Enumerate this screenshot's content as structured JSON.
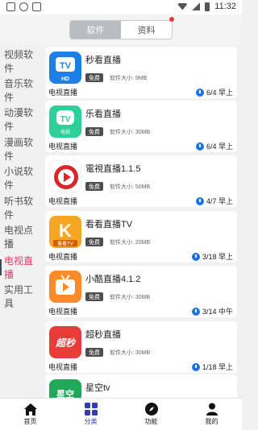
{
  "status": {
    "time": "11:32"
  },
  "segment": {
    "tabs": [
      "软件",
      "资料"
    ],
    "active": 0
  },
  "sidebar": {
    "items": [
      "视频软件",
      "音乐软件",
      "动漫软件",
      "漫画软件",
      "小说软件",
      "听书软件",
      "电视点播",
      "电视直播",
      "实用工具"
    ],
    "active_index": 7
  },
  "apps": [
    {
      "name": "秒看直播",
      "badge": "免费",
      "size": "软件大小: 9MB",
      "category": "电视直播",
      "date": "6/4 早上",
      "icon_text": "TV",
      "icon_sub": "HD",
      "icon_color": "#1e7fe6"
    },
    {
      "name": "乐看直播",
      "badge": "免费",
      "size": "软件大小: 30MB",
      "category": "电视直播",
      "date": "6/4 早上",
      "icon_text": "TV",
      "icon_sub": "电视",
      "icon_color": "#2fcf9a"
    },
    {
      "name": "電視直播1.1.5",
      "badge": "免费",
      "size": "软件大小: 50MB",
      "category": "电视直播",
      "date": "4/7 早上",
      "icon_text": "",
      "icon_sub": "",
      "icon_color": "#d92626"
    },
    {
      "name": "看看直播TV",
      "badge": "免费",
      "size": "软件大小: 20MB",
      "category": "电视直播",
      "date": "3/18 早上",
      "icon_text": "K",
      "icon_sub": "看看TV",
      "icon_color": "#f5a623"
    },
    {
      "name": "小酷直播4.1.2",
      "badge": "免费",
      "size": "软件大小: 30MB",
      "category": "电视直播",
      "date": "3/14 中午",
      "icon_text": "",
      "icon_sub": "",
      "icon_color": "#ff8a2a"
    },
    {
      "name": "超秒直播",
      "badge": "免费",
      "size": "软件大小: 30MB",
      "category": "电视直播",
      "date": "1/18 早上",
      "icon_text": "超秒",
      "icon_sub": "",
      "icon_color": "#ea3b3b"
    },
    {
      "name": "星空tv",
      "badge": "",
      "size": "",
      "category": "",
      "date": "",
      "icon_text": "星空",
      "icon_sub": "",
      "icon_color": "#23a85a"
    }
  ],
  "tabbar": {
    "items": [
      "首页",
      "分类",
      "功能",
      "我的"
    ],
    "active_index": 1
  },
  "colors": {
    "accent": "#e83e6b",
    "tab_active": "#2f3fb0",
    "clock": "#1a73e8"
  }
}
